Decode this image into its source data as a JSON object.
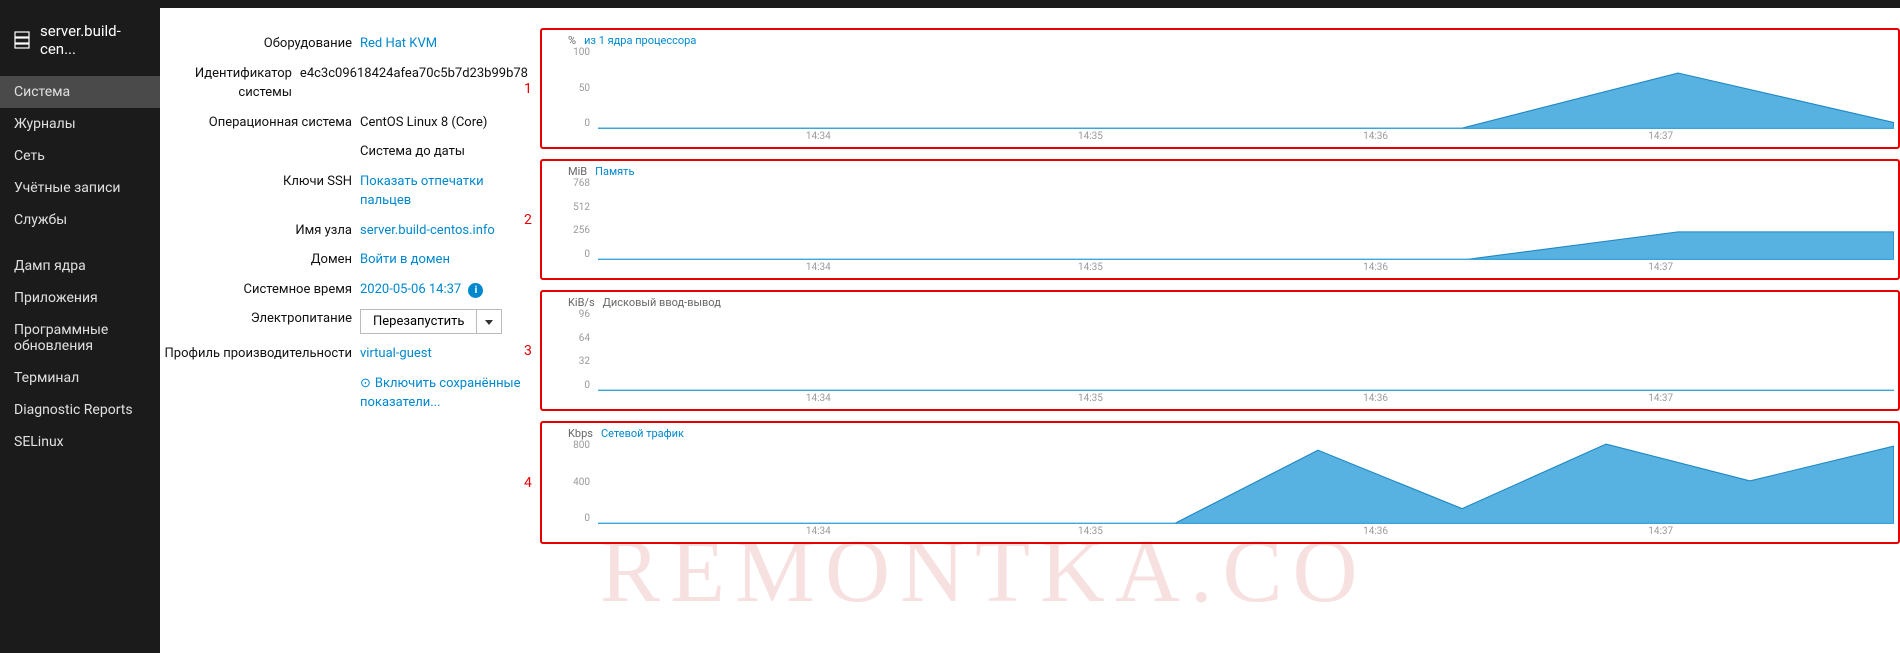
{
  "host": "server.build-cen...",
  "nav": [
    {
      "id": "system",
      "label": "Система",
      "active": true
    },
    {
      "id": "logs",
      "label": "Журналы"
    },
    {
      "id": "net",
      "label": "Сеть"
    },
    {
      "id": "accounts",
      "label": "Учётные записи"
    },
    {
      "id": "services",
      "label": "Службы"
    },
    {
      "spacer": true
    },
    {
      "id": "kdump",
      "label": "Дамп ядра"
    },
    {
      "id": "apps",
      "label": "Приложения"
    },
    {
      "id": "updates",
      "label": "Программные обновления"
    },
    {
      "id": "terminal",
      "label": "Терминал"
    },
    {
      "id": "diag",
      "label": "Diagnostic Reports"
    },
    {
      "id": "selinux",
      "label": "SELinux"
    }
  ],
  "info": [
    {
      "label": "Оборудование",
      "value": "Red Hat KVM",
      "link": true
    },
    {
      "label": "Идентификатор системы",
      "value": "e4c3c09618424afea70c5b7d23b99b78"
    },
    {
      "label": "Операционная система",
      "value": "CentOS Linux 8 (Core)"
    },
    {
      "label": "",
      "value": "Система до даты"
    },
    {
      "label": "Ключи SSH",
      "value": "Показать отпечатки пальцев",
      "link": true
    },
    {
      "label": "Имя узла",
      "value": "server.build-centos.info",
      "link": true
    },
    {
      "label": "Домен",
      "value": "Войти в домен",
      "link": true
    },
    {
      "label": "Системное время",
      "value": "2020-05-06 14:37",
      "link": true,
      "icon": true
    },
    {
      "label": "Электропитание",
      "btn": "Перезапустить"
    },
    {
      "label": "Профиль производительности",
      "value": "virtual-guest",
      "link": true
    },
    {
      "label": "",
      "value": "Включить сохранённые показатели...",
      "link": true,
      "warn": true
    }
  ],
  "xticks": [
    "14:34",
    "14:35",
    "14:36",
    "14:37"
  ],
  "xpos": [
    17,
    38,
    60,
    82
  ],
  "chart_data": [
    {
      "type": "area",
      "unit": "%",
      "title": "из 1 ядра процессора",
      "title_link": true,
      "ylim": [
        0,
        100
      ],
      "yticks": [
        100,
        50,
        0
      ],
      "height": 100,
      "x_time": [
        "14:33",
        "14:34",
        "14:35",
        "14:36",
        "14:37",
        "14:37:30",
        "14:38"
      ],
      "values": [
        1,
        1,
        1,
        1,
        1,
        70,
        8
      ]
    },
    {
      "type": "area",
      "unit": "MiB",
      "title": "Память",
      "title_link": true,
      "ylim": [
        0,
        768
      ],
      "yticks": [
        768,
        512,
        256,
        0
      ],
      "height": 100,
      "x_time": [
        "14:33",
        "14:34",
        "14:35",
        "14:36",
        "14:37",
        "14:37:10",
        "14:38"
      ],
      "values": [
        0,
        0,
        0,
        0,
        0,
        270,
        270
      ]
    },
    {
      "type": "area",
      "unit": "KiB/s",
      "title": "Дисковый ввод-вывод",
      "title_link": false,
      "ylim": [
        0,
        96
      ],
      "yticks": [
        96,
        64,
        32,
        0
      ],
      "height": 100,
      "x_time": [
        "14:33",
        "14:34",
        "14:35",
        "14:36",
        "14:37",
        "14:38"
      ],
      "values": [
        0,
        0,
        0,
        0,
        0,
        0
      ]
    },
    {
      "type": "area",
      "unit": "Kbps",
      "title": "Сетевой трафик",
      "title_link": true,
      "ylim": [
        0,
        800
      ],
      "yticks": [
        800,
        400,
        0
      ],
      "height": 102,
      "x_time": [
        "14:33",
        "14:34",
        "14:35",
        "14:36",
        "14:37",
        "14:37:15",
        "14:37:25",
        "14:37:35",
        "14:37:45",
        "14:38"
      ],
      "values": [
        2,
        2,
        2,
        2,
        2,
        720,
        150,
        780,
        420,
        760
      ]
    }
  ],
  "watermark": "REMONTKA.CO"
}
